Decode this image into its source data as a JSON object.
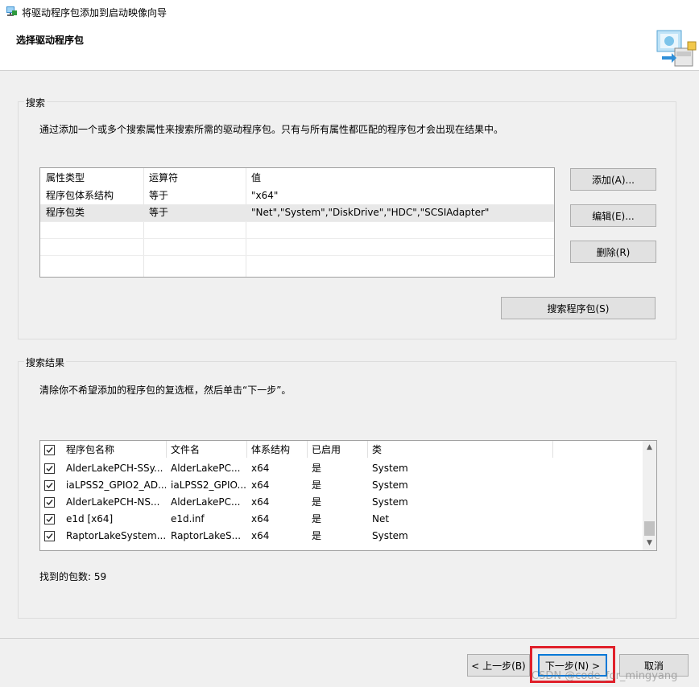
{
  "window": {
    "title": "将驱动程序包添加到启动映像向导"
  },
  "header": {
    "title": "选择驱动程序包"
  },
  "search_group": {
    "label": "搜索",
    "description": "通过添加一个或多个搜索属性来搜索所需的驱动程序包。只有与所有属性都匹配的程序包才会出现在结果中。",
    "columns": [
      "属性类型",
      "运算符",
      "值"
    ],
    "rows": [
      [
        "程序包体系结构",
        "等于",
        "\"x64\""
      ],
      [
        "程序包类",
        "等于",
        "\"Net\",\"System\",\"DiskDrive\",\"HDC\",\"SCSIAdapter\""
      ]
    ],
    "buttons": {
      "add": "添加(A)...",
      "edit": "编辑(E)...",
      "delete": "删除(R)",
      "search": "搜索程序包(S)"
    }
  },
  "results_group": {
    "label": "搜索结果",
    "description": "清除你不希望添加的程序包的复选框，然后单击“下一步”。",
    "columns": [
      "程序包名称",
      "文件名",
      "体系结构",
      "已启用",
      "类"
    ],
    "rows": [
      [
        "AlderLakePCH-SSy...",
        "AlderLakePC...",
        "x64",
        "是",
        "System"
      ],
      [
        "iaLPSS2_GPIO2_AD...",
        "iaLPSS2_GPIO...",
        "x64",
        "是",
        "System"
      ],
      [
        "AlderLakePCH-NS...",
        "AlderLakePC...",
        "x64",
        "是",
        "System"
      ],
      [
        "e1d [x64]",
        "e1d.inf",
        "x64",
        "是",
        "Net"
      ],
      [
        "RaptorLakeSystem...",
        "RaptorLakeS...",
        "x64",
        "是",
        "System"
      ]
    ],
    "found_label": "找到的包数: 59"
  },
  "footer": {
    "prev_label": "< 上一步(B)",
    "next_label": "下一步(N) >",
    "cancel_label": "取消",
    "watermark": "CSDN @code_for_mingyang"
  },
  "colors": {
    "highlight": "#e0202a",
    "default_button_border": "#0078d7"
  }
}
